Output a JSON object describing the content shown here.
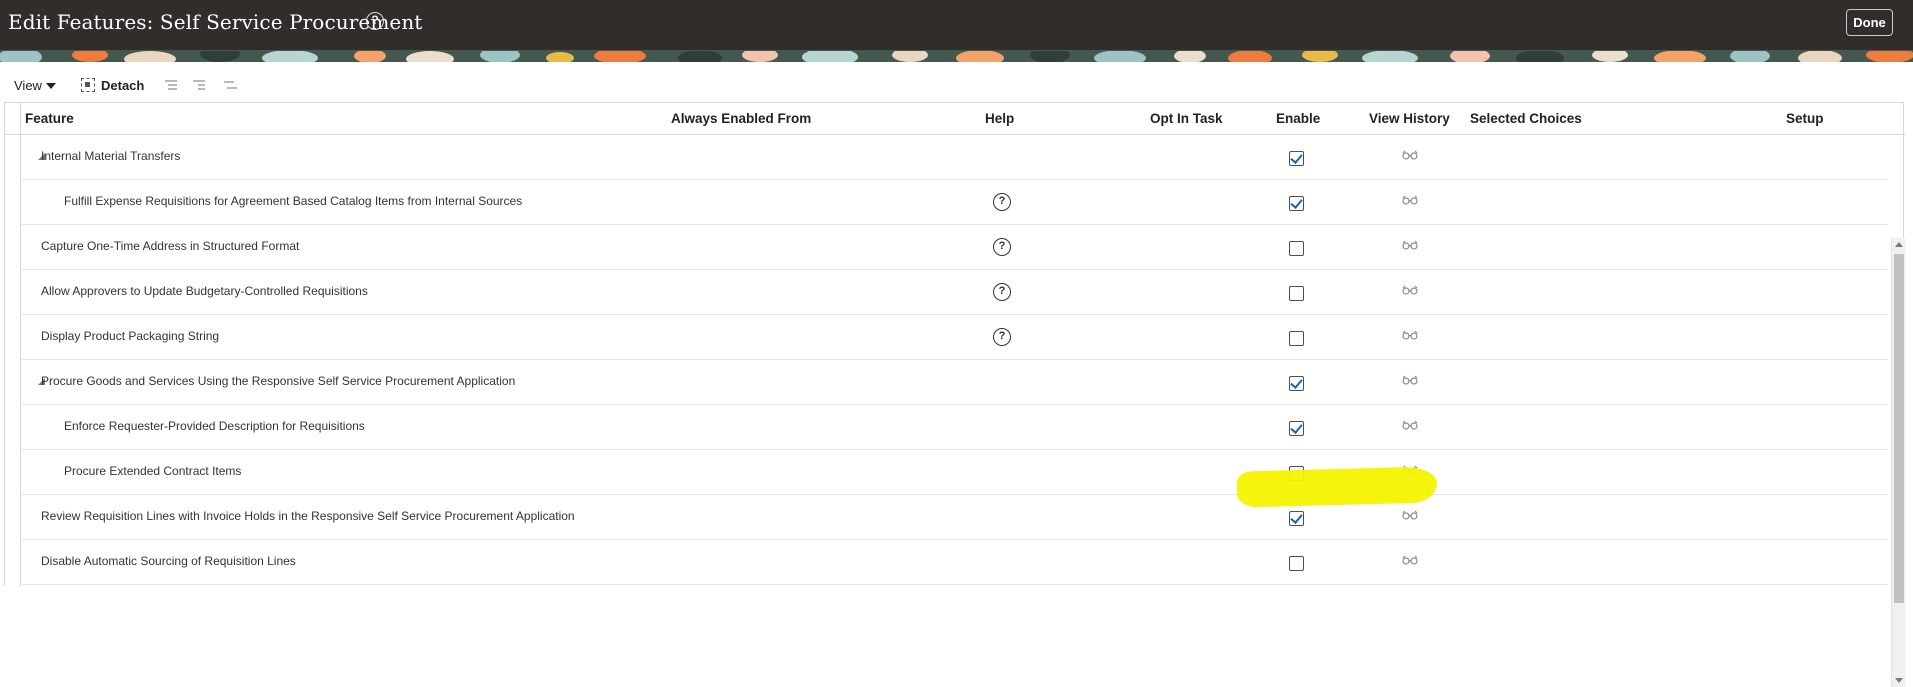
{
  "header": {
    "title": "Edit Features: Self Service Procurement",
    "help_glyph": "?",
    "done_label": "Done"
  },
  "toolbar": {
    "view_label": "View",
    "detach_label": "Detach"
  },
  "table": {
    "columns": [
      "Feature",
      "Always Enabled From",
      "Help",
      "Opt In Task",
      "Enable",
      "View History",
      "Selected Choices",
      "Setup"
    ],
    "rows": [
      {
        "label": "Internal Material Transfers",
        "level": 0,
        "expandable": true,
        "help": false,
        "enabled": true
      },
      {
        "label": "Fulfill Expense Requisitions for Agreement Based Catalog Items from Internal Sources",
        "level": 1,
        "expandable": false,
        "help": true,
        "enabled": true
      },
      {
        "label": "Capture One-Time Address in Structured Format",
        "level": 0,
        "expandable": false,
        "help": true,
        "enabled": false
      },
      {
        "label": "Allow Approvers to Update Budgetary-Controlled Requisitions",
        "level": 0,
        "expandable": false,
        "help": true,
        "enabled": false
      },
      {
        "label": "Display Product Packaging String",
        "level": 0,
        "expandable": false,
        "help": true,
        "enabled": false
      },
      {
        "label": "Procure Goods and Services Using the Responsive Self Service Procurement Application",
        "level": 0,
        "expandable": true,
        "help": false,
        "enabled": true
      },
      {
        "label": "Enforce Requester-Provided Description for Requisitions",
        "level": 1,
        "expandable": false,
        "help": false,
        "enabled": true
      },
      {
        "label": "Procure Extended Contract Items",
        "level": 1,
        "expandable": false,
        "help": false,
        "enabled": false
      },
      {
        "label": "Review Requisition Lines with Invoice Holds in the Responsive Self Service Procurement Application",
        "level": 0,
        "expandable": false,
        "help": false,
        "enabled": true
      },
      {
        "label": "Disable Automatic Sourcing of Requisition Lines",
        "level": 0,
        "expandable": false,
        "help": false,
        "enabled": false
      }
    ]
  },
  "icons": {
    "help": "help-circle-icon",
    "history": "glasses-icon",
    "detach": "detach-icon"
  },
  "colors": {
    "header_bg": "#312d2a",
    "check_blue": "#1f62b3",
    "highlight": "#f5f200"
  }
}
